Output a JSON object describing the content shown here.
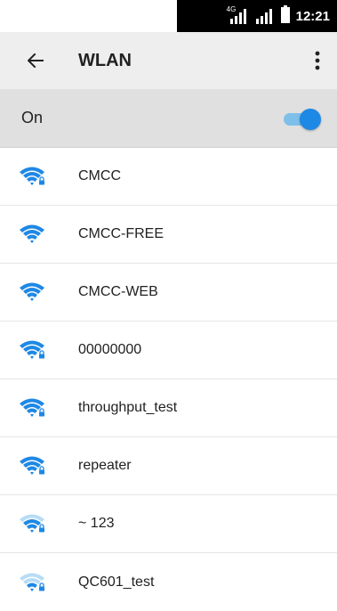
{
  "status": {
    "network_label": "4G",
    "time": "12:21"
  },
  "app_bar": {
    "title": "WLAN"
  },
  "master": {
    "label": "On",
    "enabled": true
  },
  "networks": [
    {
      "ssid": "CMCC",
      "secured": true,
      "strength": "full"
    },
    {
      "ssid": "CMCC-FREE",
      "secured": false,
      "strength": "full"
    },
    {
      "ssid": "CMCC-WEB",
      "secured": false,
      "strength": "full"
    },
    {
      "ssid": "00000000",
      "secured": true,
      "strength": "full"
    },
    {
      "ssid": "throughput_test",
      "secured": true,
      "strength": "full"
    },
    {
      "ssid": "repeater",
      "secured": true,
      "strength": "full"
    },
    {
      "ssid": "~ 123",
      "secured": true,
      "strength": "medium"
    },
    {
      "ssid": "QC601_test",
      "secured": true,
      "strength": "weak"
    }
  ],
  "colors": {
    "wifi_active": "#1e88e5",
    "wifi_faded": "#b7dcf6",
    "toggle_thumb": "#1e88e5",
    "toggle_track": "#7ec0ea"
  }
}
